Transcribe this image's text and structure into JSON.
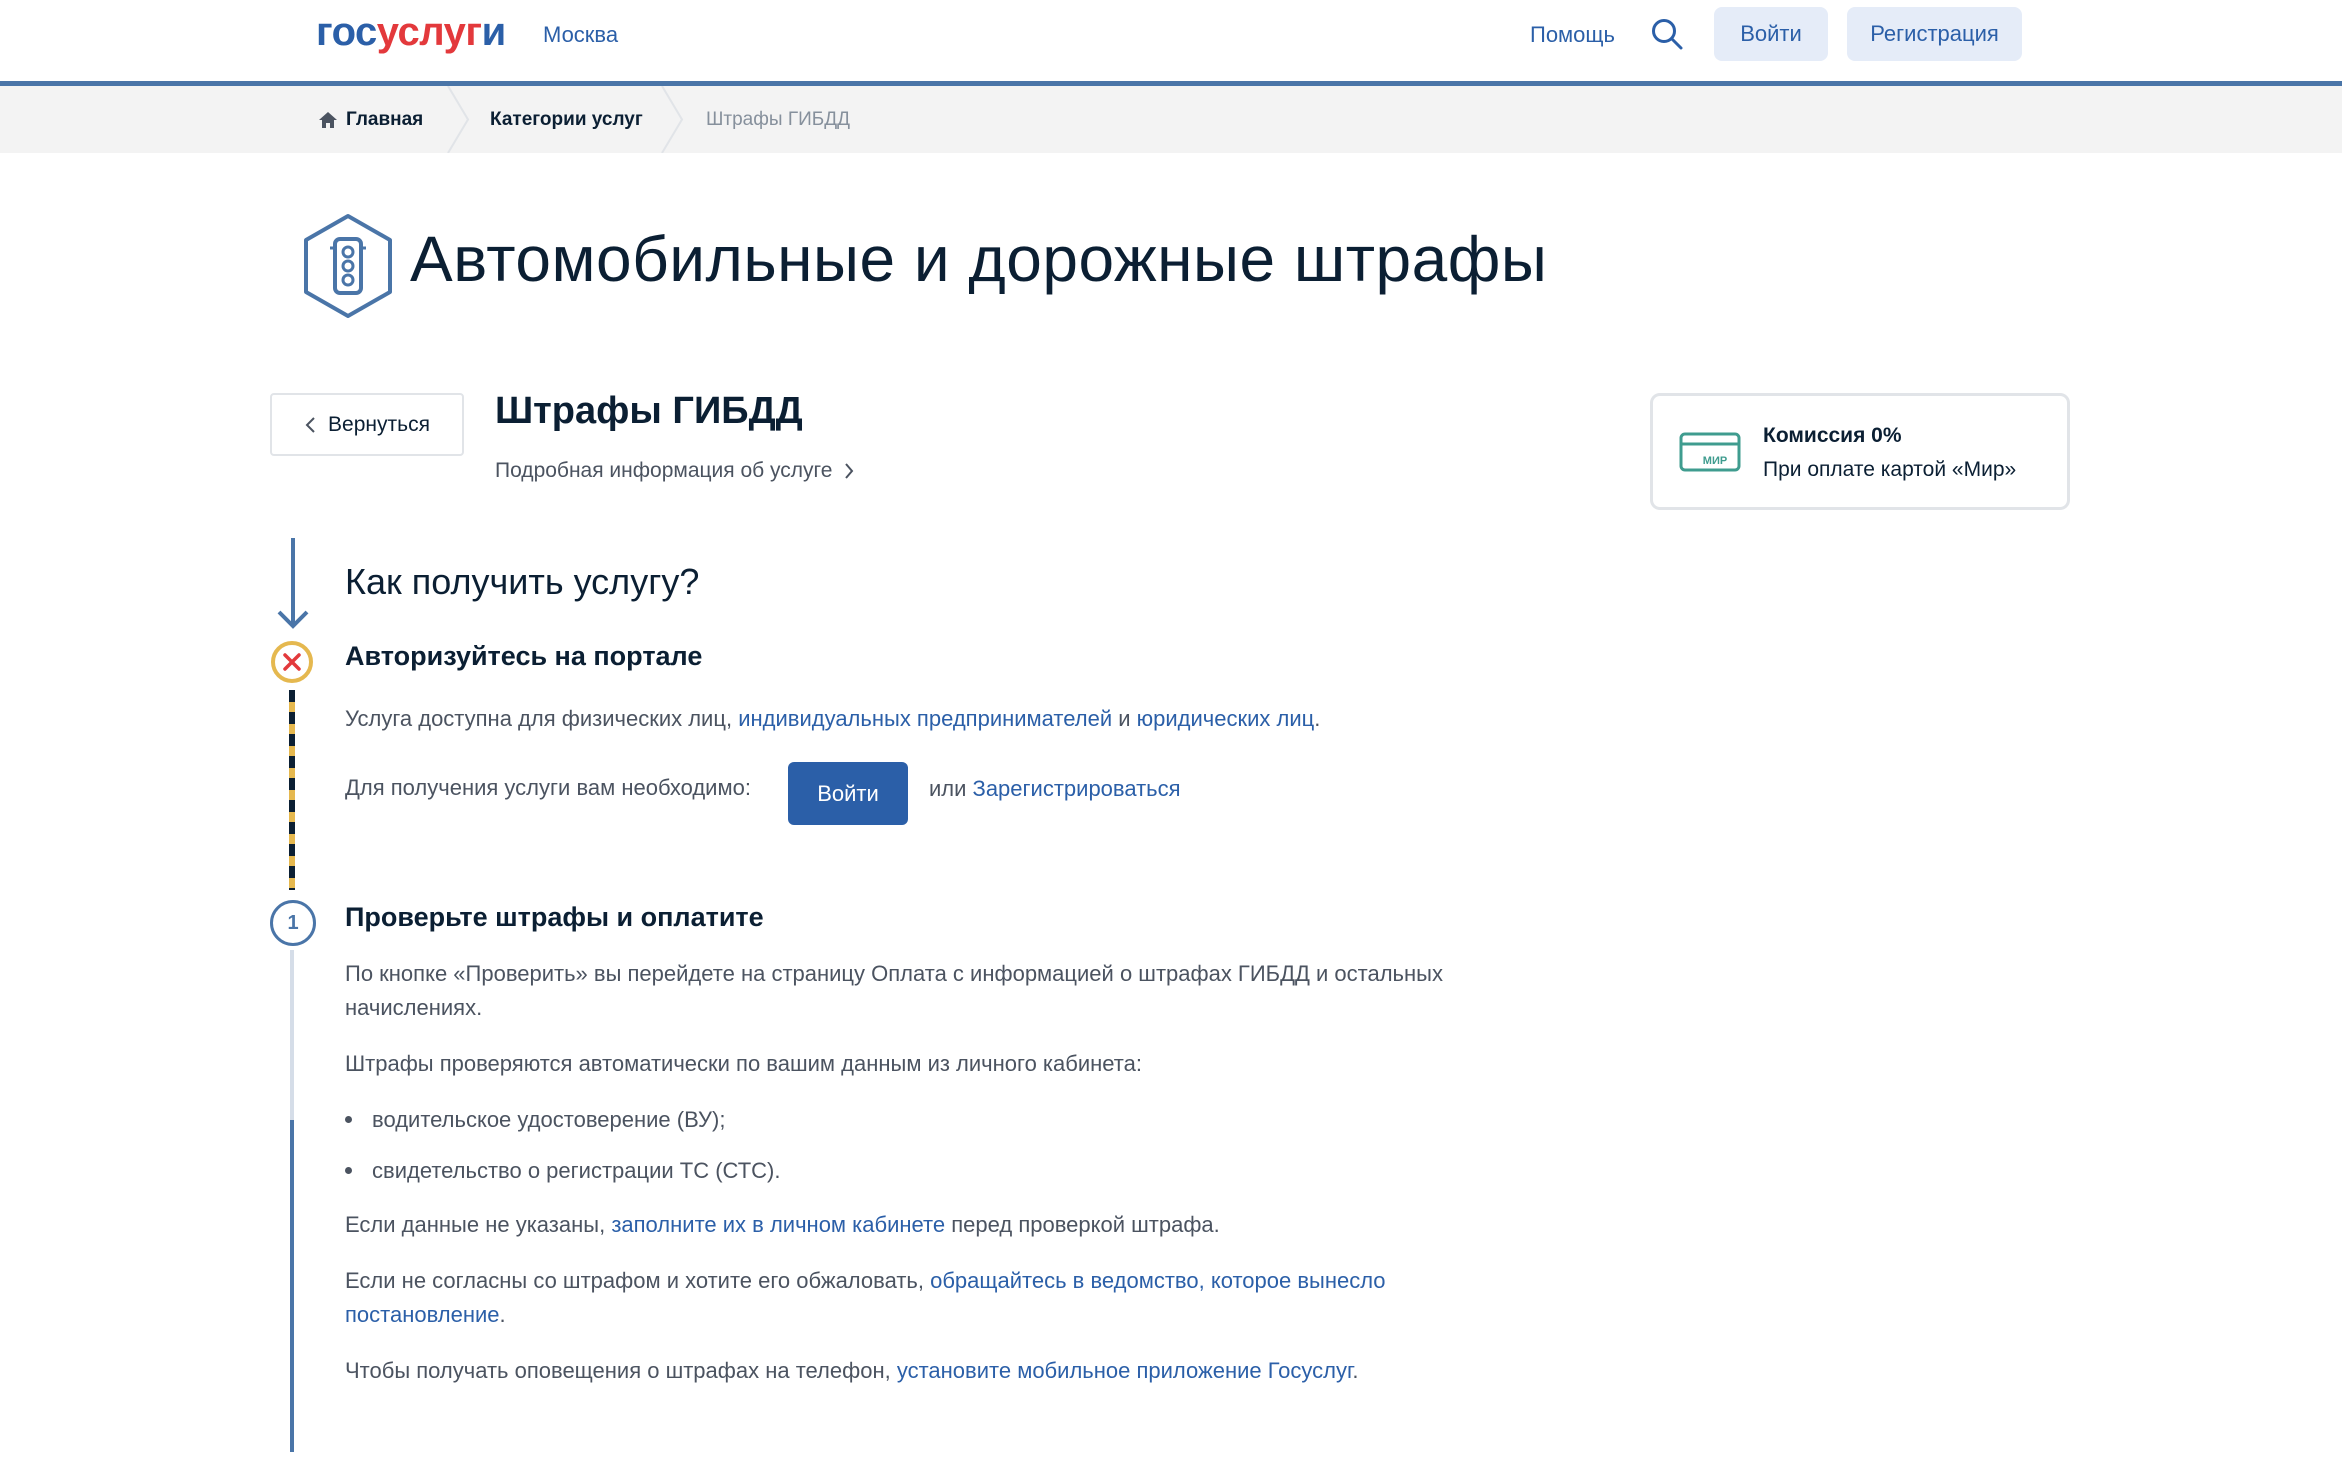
{
  "header": {
    "logo_gos": "гос",
    "logo_usl": "услуг",
    "logo_ru": "и",
    "city": "Москва",
    "help": "Помощь",
    "login": "Войти",
    "register": "Регистрация"
  },
  "breadcrumb": {
    "home": "Главная",
    "categories": "Категории услуг",
    "current": "Штрафы ГИБДД"
  },
  "page": {
    "title": "Автомобильные и дорожные штрафы",
    "back": "Вернуться",
    "service_title": "Штрафы ГИБДД",
    "service_more": "Подробная информация об услуге"
  },
  "commission": {
    "card_label": "МИР",
    "title": "Комиссия 0%",
    "subtitle": "При оплате картой «Мир»"
  },
  "how": {
    "question": "Как получить услугу?",
    "step_number": "1",
    "step1": {
      "title": "Авторизуйтесь на портале",
      "text_a": "Услуга доступна для физических лиц, ",
      "link_ip": "индивидуальных предпринимателей",
      "text_and": " и ",
      "link_ul": "юридических лиц",
      "text_dot": ".",
      "need": "Для получения услуги вам необходимо:",
      "login_btn": "Войти",
      "or": "или ",
      "register_link": "Зарегистрироваться"
    },
    "step2": {
      "title": "Проверьте штрафы и оплатите",
      "p1_line1": "По кнопке «Проверить» вы перейдете на страницу Оплата с информацией о штрафах ГИБДД и остальных",
      "p1_line2": "начислениях.",
      "p2": "Штрафы проверяются автоматически по вашим данным из личного кабинета:",
      "bullet1": "водительское удостоверение (ВУ);",
      "bullet2": "свидетельство о регистрации ТС (СТС).",
      "p3_a": "Если данные не указаны, ",
      "p3_link": "заполните их в личном кабинете",
      "p3_b": " перед проверкой штрафа.",
      "p4_a": "Если не согласны со штрафом и хотите его обжаловать, ",
      "p4_link1": "обращайтесь в ведомство, которое вынесло",
      "p4_link2": "постановление",
      "p4_dot": ".",
      "p5_a": "Чтобы получать оповещения о штрафах на телефон, ",
      "p5_link": "установите мобильное приложение Госуслуг",
      "p5_dot": "."
    }
  },
  "colors": {
    "brand_blue": "#2b5fa8",
    "brand_red": "#e3393c",
    "warning_yellow": "#e5b84f"
  }
}
